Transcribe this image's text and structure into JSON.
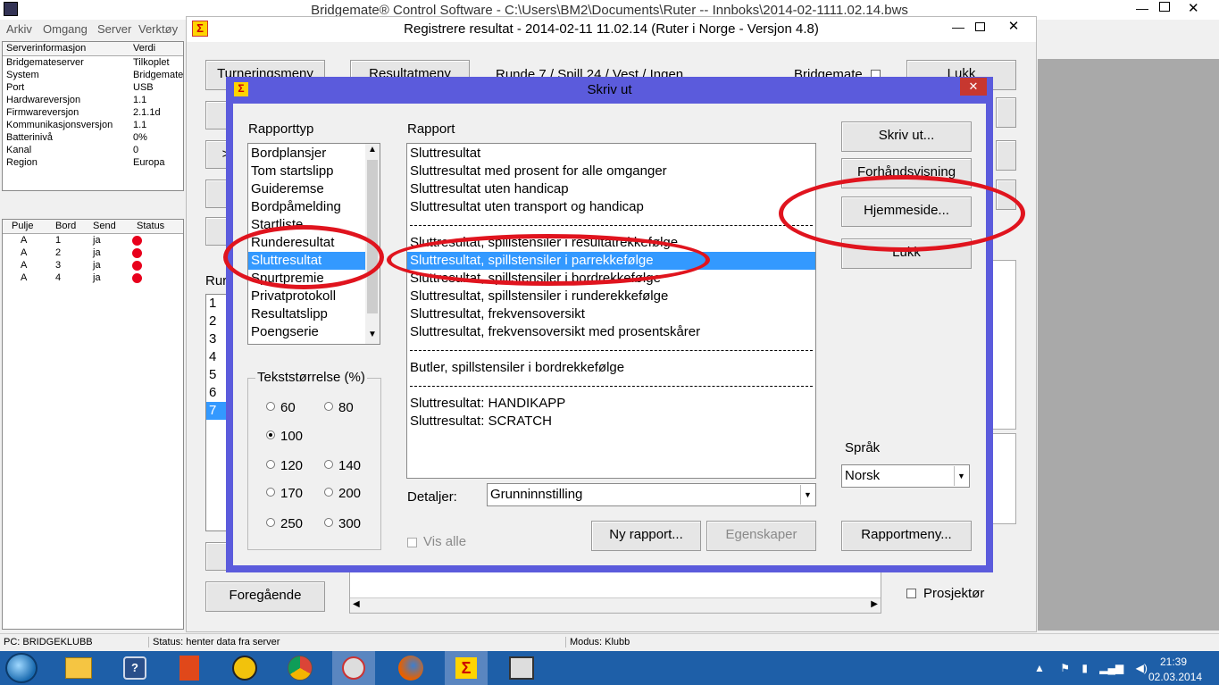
{
  "app": {
    "title": "Bridgemate® Control Software - C:\\Users\\BM2\\Documents\\Ruter -- Innboks\\2014-02-1111.02.14.bws",
    "menu": [
      "Arkiv",
      "Omgang",
      "Server",
      "Verktøy"
    ],
    "server_headers": [
      "Serverinformasjon",
      "Verdi"
    ],
    "server_rows": [
      [
        "Bridgemateserver",
        "Tilkoplet"
      ],
      [
        "System",
        "Bridgemate"
      ],
      [
        "Port",
        "USB"
      ],
      [
        "Hardwareversjon",
        "1.1"
      ],
      [
        "Firmwareversjon",
        "2.1.1d"
      ],
      [
        "Kommunikasjonsversjon",
        "1.1"
      ],
      [
        "Batterinivå",
        "0%"
      ],
      [
        "Kanal",
        "0"
      ],
      [
        "Region",
        "Europa"
      ]
    ],
    "table_headers": [
      "Pulje",
      "Bord",
      "Send",
      "Status"
    ],
    "table_rows": [
      [
        "A",
        "1",
        "ja"
      ],
      [
        "A",
        "2",
        "ja"
      ],
      [
        "A",
        "3",
        "ja"
      ],
      [
        "A",
        "4",
        "ja"
      ]
    ],
    "status_pc": "PC: BRIDGEKLUBB",
    "status_text": "Status: henter data fra server",
    "status_mode": "Modus: Klubb"
  },
  "register": {
    "title": "Registrere resultat - 2014-02-11  11.02.14  (Ruter i Norge - Versjon 4.8)",
    "btn_turnering": "Turneringsmeny",
    "btn_resultat": "Resultatmeny",
    "round_info": "Runde 7 / Spill 24 / Vest / Ingen",
    "bridgemate_label": "Bridgemate",
    "btn_lukk": "Lukk",
    "runde_label": "Rur",
    "rounds": [
      "1",
      "2",
      "3",
      "4",
      "5",
      "6",
      "7"
    ],
    "selected_round": "7",
    "btn_foregaende": "Foregående",
    "prosjektor_label": "Prosjektør",
    "side_button": ">"
  },
  "dialog": {
    "title": "Skriv ut",
    "rapporttype_label": "Rapporttyp",
    "rapporttype_items": [
      "Bordplansjer",
      "Tom startslipp",
      "Guideremse",
      "Bordpåmelding",
      "Startliste",
      "Runderesultat",
      "Sluttresultat",
      "Spurtpremie",
      "Privatprotokoll",
      "Resultatslipp",
      "Poengserie"
    ],
    "rapporttype_selected": "Sluttresultat",
    "rapport_label": "Rapport",
    "rapport_items": [
      "Sluttresultat",
      "Sluttresultat med prosent for alle omganger",
      "Sluttresultat uten handicap",
      "Sluttresultat uten transport og handicap",
      "---",
      "Sluttresultat, spillstensiler i resultatrekkefølge",
      "Sluttresultat, spillstensiler i parrekkefølge",
      "Sluttresultat, spillstensiler i bordrekkefølge",
      "Sluttresultat, spillstensiler i runderekkefølge",
      "Sluttresultat, frekvensoversikt",
      "Sluttresultat, frekvensoversikt med prosentskårer",
      "---",
      "Butler, spillstensiler i bordrekkefølge",
      "---",
      "Sluttresultat: HANDIKAPP",
      "Sluttresultat: SCRATCH"
    ],
    "rapport_selected": "Sluttresultat, spillstensiler i parrekkefølge",
    "textsize_label": "Tekststørrelse (%)",
    "textsize_options": [
      "60",
      "80",
      "100",
      "120",
      "140",
      "170",
      "200",
      "250",
      "300"
    ],
    "textsize_selected": "100",
    "btn_skriv_ut": "Skriv ut...",
    "btn_forhand": "Forhåndsvisning",
    "btn_hjemmeside": "Hjemmeside...",
    "btn_lukk": "Lukk",
    "sprak_label": "Språk",
    "sprak_value": "Norsk",
    "detaljer_label": "Detaljer:",
    "detaljer_value": "Grunninnstilling",
    "vis_alle_label": "Vis alle",
    "btn_ny_rapport": "Ny rapport...",
    "btn_egenskaper": "Egenskaper",
    "btn_rapportmeny": "Rapportmeny...",
    "close_glyph": "✕"
  },
  "taskbar": {
    "clock_time": "21:39",
    "clock_date": "02.03.2014"
  },
  "colors": {
    "dialog_frame": "#5b5bdc",
    "selection": "#3399ff",
    "close_red": "#c7372f",
    "annotation_red": "#e0141e",
    "taskbar": "#1e5fa8",
    "status_led": "#e8001c"
  }
}
